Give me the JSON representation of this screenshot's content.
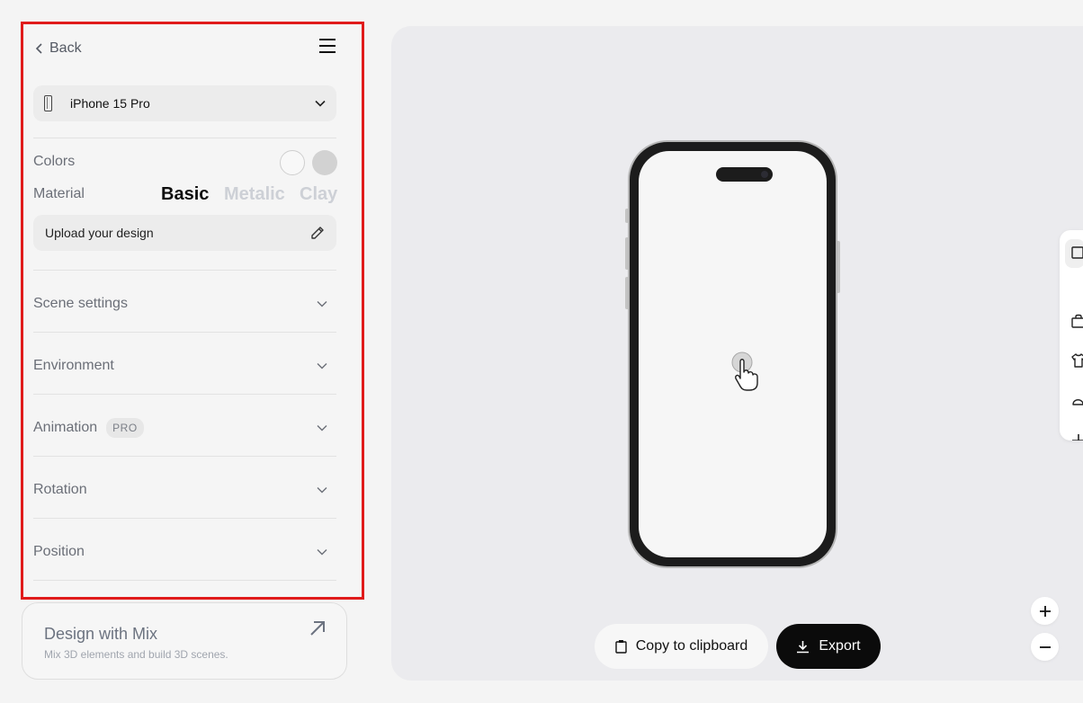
{
  "sidebar": {
    "back_label": "Back",
    "device": {
      "label": "iPhone 15 Pro"
    },
    "colors_label": "Colors",
    "material": {
      "label": "Material",
      "options": [
        "Basic",
        "Metalic",
        "Clay"
      ],
      "selected": "Basic"
    },
    "upload_label": "Upload your design",
    "sections": [
      {
        "label": "Scene settings"
      },
      {
        "label": "Environment"
      },
      {
        "label": "Animation",
        "badge": "PRO"
      },
      {
        "label": "Rotation"
      },
      {
        "label": "Position"
      }
    ]
  },
  "mix_card": {
    "title": "Design with Mix",
    "subtitle": "Mix 3D elements and build 3D scenes."
  },
  "canvas": {
    "copy_label": "Copy to clipboard",
    "export_label": "Export"
  },
  "colors": {
    "accent_outline": "#e01b1b",
    "export_bg": "#0b0b0b",
    "swatch_white": "#f8f8f8",
    "swatch_gray": "#d2d2d2"
  }
}
